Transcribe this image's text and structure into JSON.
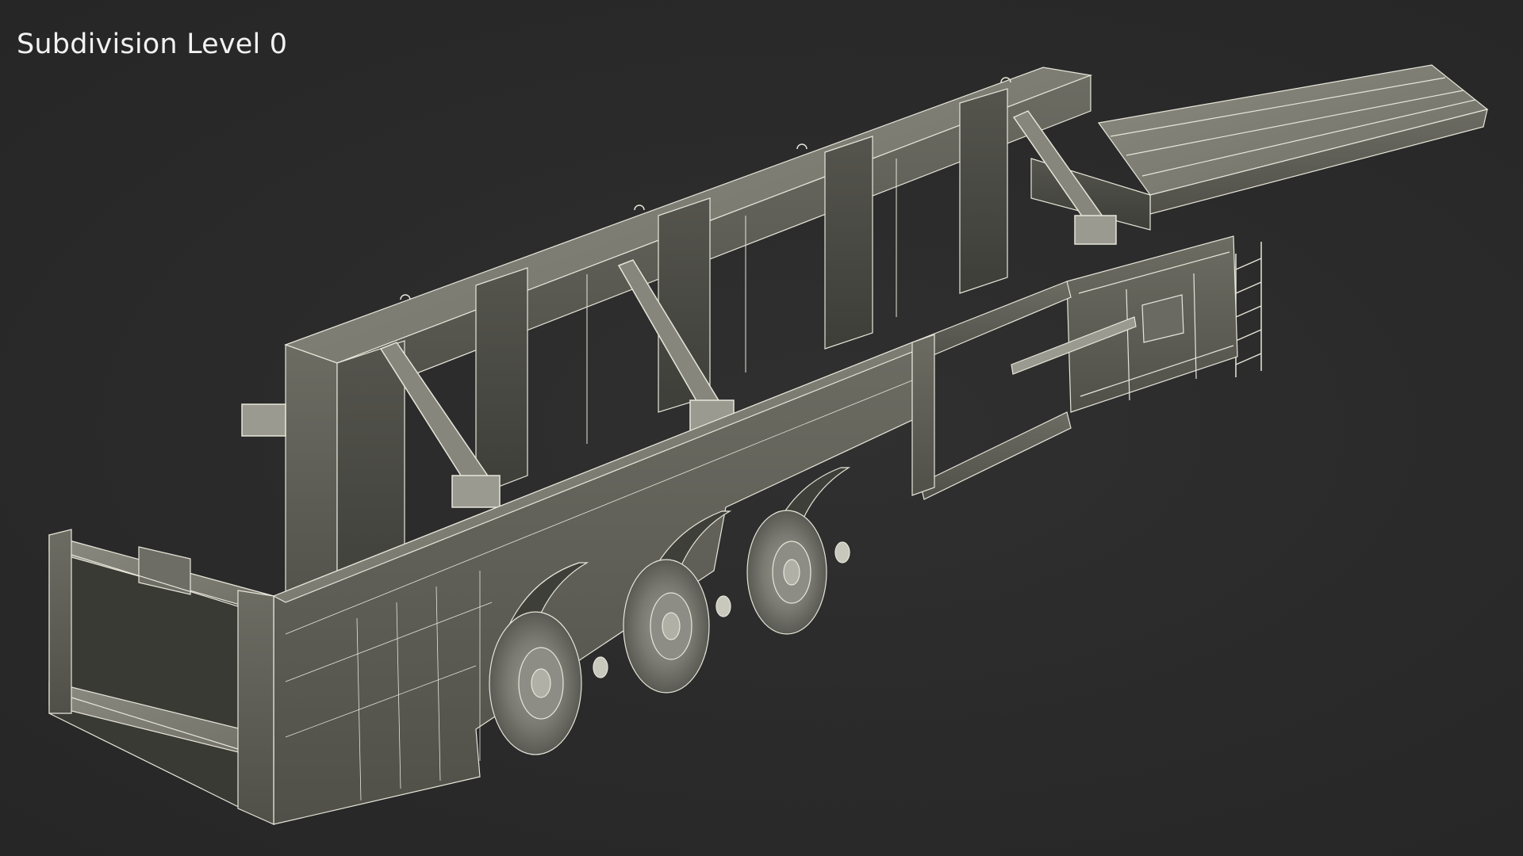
{
  "viewport": {
    "label": "Subdivision Level 0",
    "background_color": "#2b2b2b",
    "model_fill_color": "#7a7a70",
    "wire_color": "#e8e8dc"
  }
}
